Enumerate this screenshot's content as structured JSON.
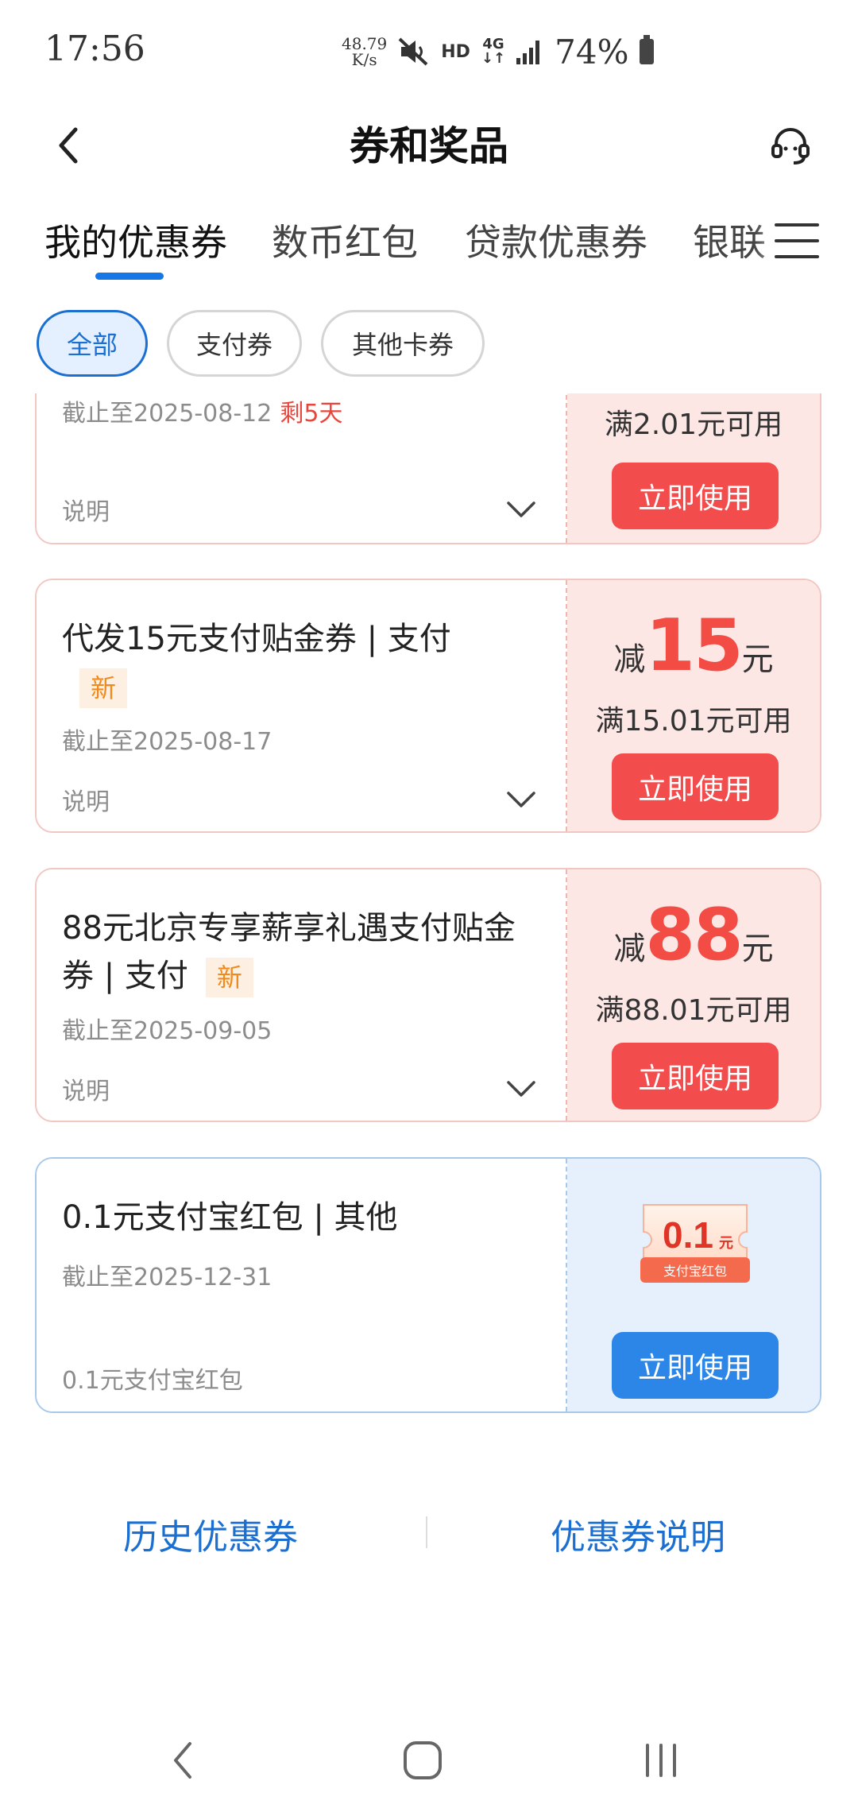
{
  "status_bar": {
    "time": "17:56",
    "net_speed_value": "48.79",
    "net_speed_unit": "K/s",
    "hd": "HD",
    "network": "4G",
    "battery": "74%"
  },
  "header": {
    "title": "券和奖品"
  },
  "tabs": [
    {
      "label": "我的优惠券",
      "active": true
    },
    {
      "label": "数币红包",
      "active": false
    },
    {
      "label": "贷款优惠券",
      "active": false
    },
    {
      "label": "银联",
      "active": false
    }
  ],
  "filters": [
    {
      "label": "全部",
      "active": true
    },
    {
      "label": "支付券",
      "active": false
    },
    {
      "label": "其他卡券",
      "active": false
    }
  ],
  "coupons": [
    {
      "expire": "截止至2025-08-12",
      "remain": "剩5天",
      "desc": "说明",
      "threshold": "满2.01元可用",
      "button": "立即使用"
    },
    {
      "title": "代发15元支付贴金券 | 支付",
      "badge": "新",
      "expire": "截止至2025-08-17",
      "desc": "说明",
      "amount_label": "减",
      "amount": "15",
      "amount_unit": "元",
      "threshold": "满15.01元可用",
      "button": "立即使用"
    },
    {
      "title": "88元北京专享薪享礼遇支付贴金券 | 支付",
      "badge": "新",
      "expire": "截止至2025-09-05",
      "desc": "说明",
      "amount_label": "减",
      "amount": "88",
      "amount_unit": "元",
      "threshold": "满88.01元可用",
      "button": "立即使用"
    },
    {
      "title": "0.1元支付宝红包 |  其他",
      "expire": "截止至2025-12-31",
      "desc": "0.1元支付宝红包",
      "image_amount": "0.1",
      "image_unit": "元",
      "image_caption": "支付宝红包",
      "button": "立即使用"
    }
  ],
  "footer": {
    "history": "历史优惠券",
    "explain": "优惠券说明"
  },
  "colors": {
    "accent_blue": "#1a6fd1",
    "coupon_red": "#f24c4c",
    "button_blue": "#2c86e8"
  }
}
